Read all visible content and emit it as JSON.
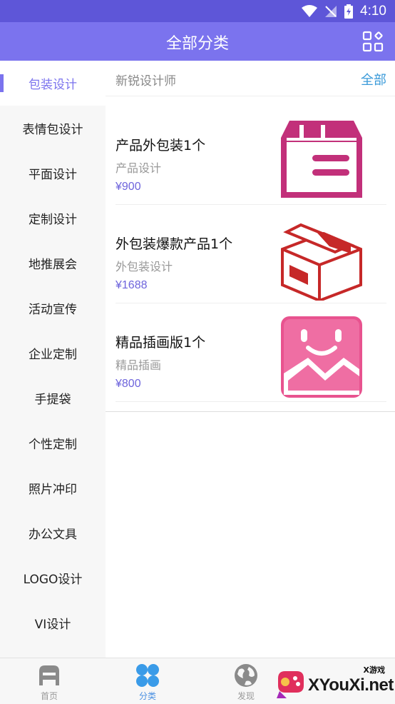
{
  "status_bar": {
    "time": "4:10",
    "icons": [
      "wifi-icon",
      "signal-off-icon",
      "battery-charging-icon"
    ]
  },
  "app_bar": {
    "title": "全部分类",
    "action_icon": "grid-apps-icon"
  },
  "sidebar": {
    "items": [
      {
        "label": "包装设计",
        "active": true
      },
      {
        "label": "表情包设计"
      },
      {
        "label": "平面设计"
      },
      {
        "label": "定制设计"
      },
      {
        "label": "地推展会"
      },
      {
        "label": "活动宣传"
      },
      {
        "label": "企业定制"
      },
      {
        "label": "手提袋"
      },
      {
        "label": "个性定制"
      },
      {
        "label": "照片冲印"
      },
      {
        "label": "办公文具"
      },
      {
        "label": "LOGO设计"
      },
      {
        "label": "VI设计"
      }
    ]
  },
  "content": {
    "header": {
      "title": "新锐设计师",
      "all_link": "全部"
    },
    "products": [
      {
        "name": "产品外包装1个",
        "category": "产品设计",
        "price": "¥900",
        "thumb_icon": "package-box-icon"
      },
      {
        "name": "外包装爆款产品1个",
        "category": "外包装设计",
        "price": "¥1688",
        "thumb_icon": "open-box-icon"
      },
      {
        "name": "精品插画版1个",
        "category": "精品插画",
        "price": "¥800",
        "thumb_icon": "smiley-picture-icon"
      }
    ]
  },
  "tab_bar": {
    "tabs": [
      {
        "label": "首页",
        "icon": "home-icon"
      },
      {
        "label": "分类",
        "icon": "category-icon",
        "active": true
      },
      {
        "label": "发现",
        "icon": "globe-icon"
      }
    ]
  },
  "watermark": {
    "text": "XYouXi.net",
    "tag": "X游戏"
  },
  "colors": {
    "accent": "#7b73ee",
    "status_bar": "#5e56d8",
    "price": "#6e64dc",
    "link": "#3a9ad9",
    "tab_active": "#4a90e2"
  }
}
